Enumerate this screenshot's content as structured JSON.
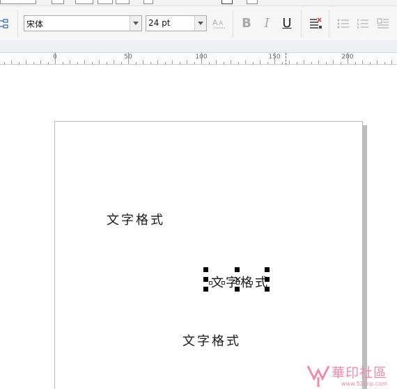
{
  "propertybar": {
    "font_name": "宋体",
    "font_size": "24 pt",
    "bold_label": "B",
    "italic_label": "I",
    "underline_label": "U"
  },
  "ruler": {
    "labels": [
      "0",
      "50",
      "100",
      "150",
      "200"
    ]
  },
  "canvas": {
    "text_objects": [
      "文字格式",
      "文字格式",
      "文字格式"
    ]
  },
  "watermark": {
    "brand": "華印社區",
    "url": "www.52cnp.com"
  },
  "colors": {
    "toolbar_bg": "#f6f6f6",
    "page_border": "#b9b9b9",
    "page_shadow": "#bdbdbd",
    "selection_handles": "#000000",
    "watermark": "#f28aa5"
  }
}
